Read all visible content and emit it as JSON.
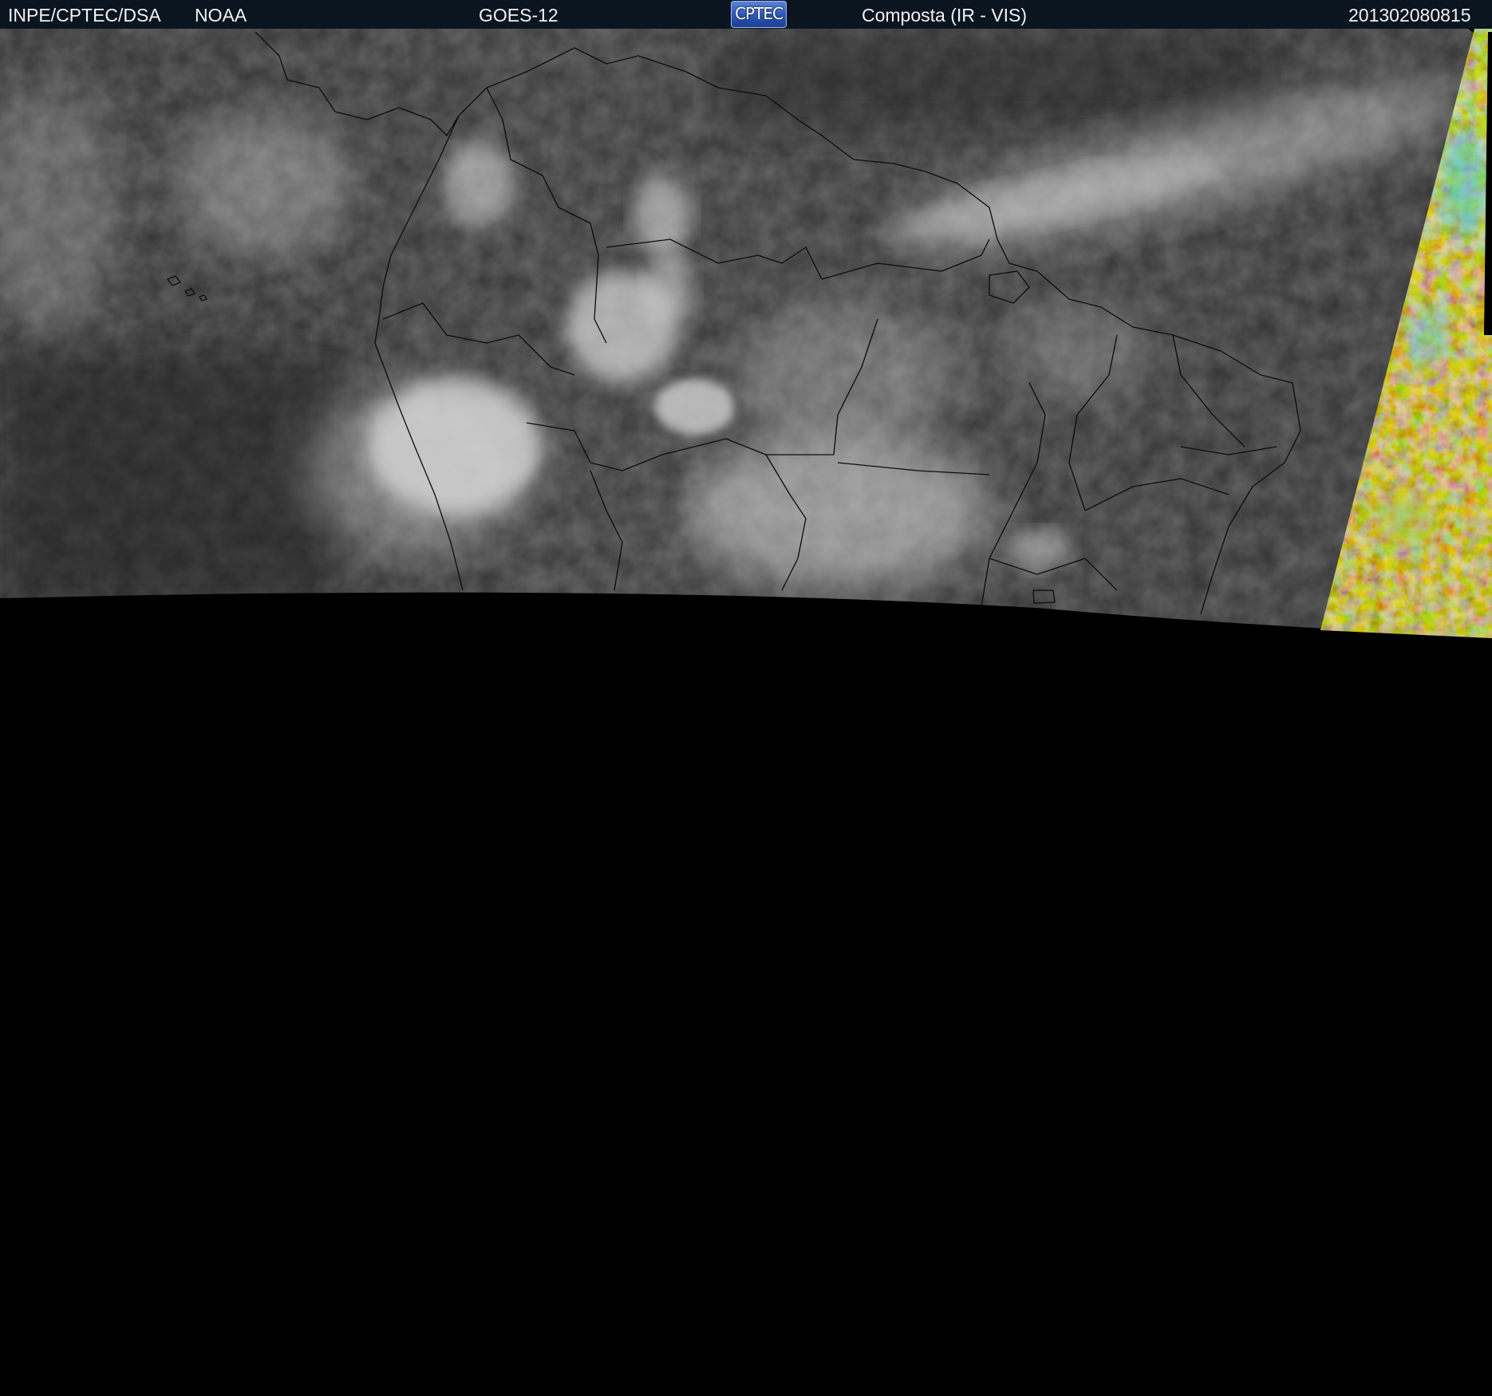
{
  "header": {
    "agency": "INPE/CPTEC/DSA",
    "provider": "NOAA",
    "satellite": "GOES-12",
    "logo_text": "CPTEC",
    "product": "Composta (IR - VIS)",
    "timestamp": "201302080815"
  },
  "colors": {
    "header_background": "#0a1520",
    "header_text": "#f2f2f2",
    "no_data": "#000000",
    "land_surface": "#353535",
    "ocean_surface": "#2b2b2b",
    "cloud_bright": "#d8d8d8",
    "visible_false_color": "#c88a3a",
    "coastline": "#0c0c0c"
  },
  "icons": {
    "logo": "cptec-logo-icon"
  }
}
